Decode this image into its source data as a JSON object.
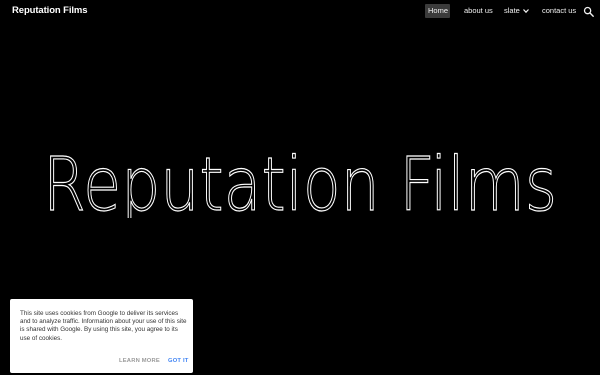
{
  "header": {
    "site_title": "Reputation Films",
    "nav": {
      "home": "Home",
      "about": "about us",
      "slate": "slate",
      "contact": "contact us"
    },
    "search_icon": "search-icon",
    "dropdown_icon": "chevron-down-icon"
  },
  "hero": {
    "title": "Reputation Films"
  },
  "cookie_notice": {
    "text": "This site uses cookies from Google to deliver its services and to analyze traffic. Information about your use of this site is shared with Google. By using this site, you agree to its use of cookies.",
    "learn_more": "LEARN MORE",
    "got_it": "GOT IT"
  },
  "colors": {
    "background": "#000000",
    "text": "#ffffff",
    "active_nav_bg": "#3b3b3b",
    "cookie_bg": "#ffffff",
    "got_it": "#4285f4",
    "learn_more": "#9a9a9a"
  }
}
